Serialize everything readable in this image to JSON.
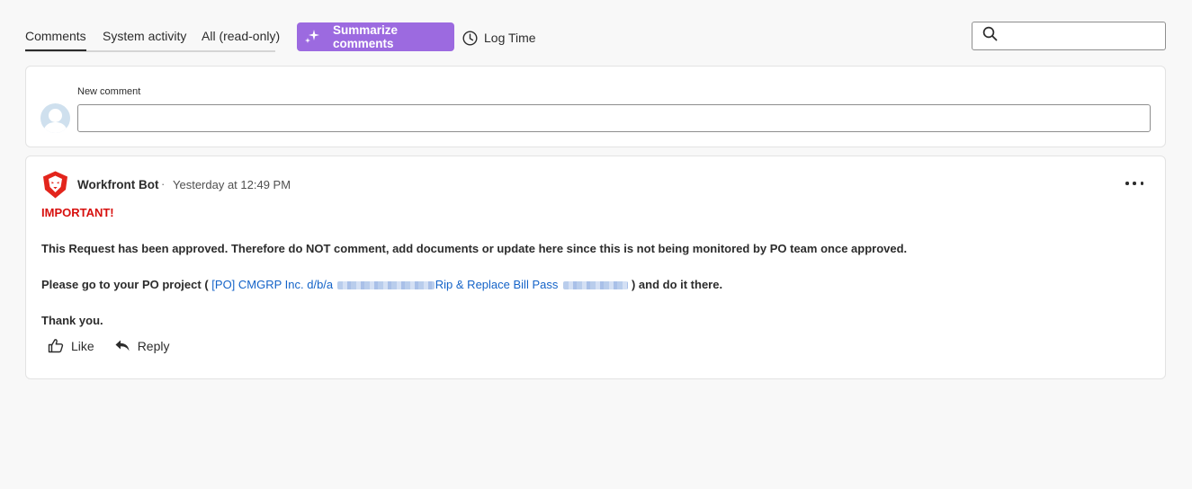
{
  "tabs": [
    {
      "label": "Comments",
      "active": true
    },
    {
      "label": "System activity",
      "active": false
    },
    {
      "label": "All (read-only)",
      "active": false
    }
  ],
  "toolbar": {
    "summarize_label": "Summarize comments",
    "summarize_color": "#9c6ae0",
    "log_time_label": "Log Time"
  },
  "search": {
    "placeholder": "",
    "value": "",
    "icon": "search-icon"
  },
  "new_comment": {
    "label": "New comment",
    "value": ""
  },
  "comment": {
    "author": "Workfront Bot",
    "separator": "·",
    "timestamp": "Yesterday at 12:49 PM",
    "important": "IMPORTANT!",
    "important_color": "#d7100e",
    "body_line1": "This Request has been approved. Therefore do NOT comment, add documents or update here since this is not being monitored by PO team once approved.",
    "body_line2_prefix": "Please go to your PO project (",
    "link_part1": "[PO] CMGRP Inc. d/b/a",
    "link_part2": "Rip & Replace Bill Pass",
    "link_color": "#1463c8",
    "body_line2_suffix": ") and do it there.",
    "body_line3": "Thank you.",
    "like_label": "Like",
    "reply_label": "Reply"
  }
}
